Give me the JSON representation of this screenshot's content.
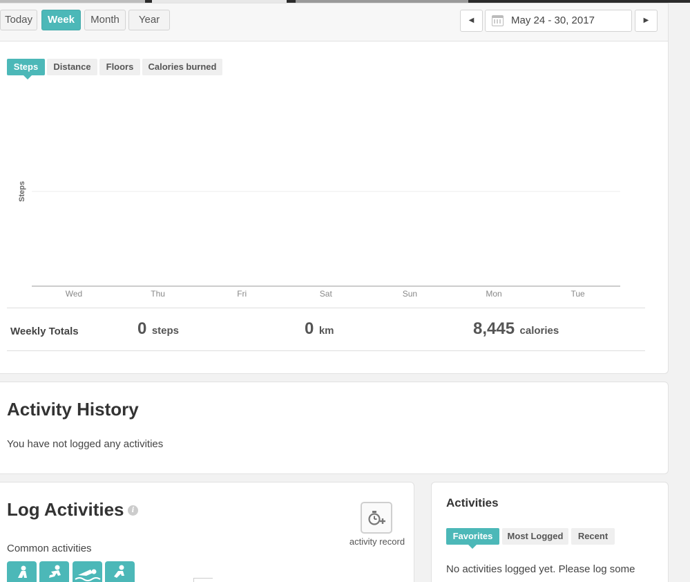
{
  "toolbar": {
    "range_buttons": [
      "Today",
      "Week",
      "Month",
      "Year"
    ],
    "active_range": "Week",
    "date_range": "May 24 - 30, 2017"
  },
  "metric_tabs": [
    "Steps",
    "Distance",
    "Floors",
    "Calories burned"
  ],
  "active_metric": "Steps",
  "chart_data": {
    "type": "bar",
    "categories": [
      "Wed",
      "Thu",
      "Fri",
      "Sat",
      "Sun",
      "Mon",
      "Tue"
    ],
    "values": [
      0,
      0,
      0,
      0,
      0,
      0,
      0
    ],
    "title": "",
    "xlabel": "",
    "ylabel": "Steps",
    "grid": true
  },
  "weekly_totals": {
    "label": "Weekly Totals",
    "steps_value": "0",
    "steps_unit": "steps",
    "distance_value": "0",
    "distance_unit": "km",
    "calories_value": "8,445",
    "calories_unit": "calories"
  },
  "activity_history": {
    "title": "Activity History",
    "message": "You have not logged any activities"
  },
  "log_activities": {
    "title": "Log Activities",
    "info_icon": "info-icon",
    "record_icon": "stopwatch-plus-icon",
    "record_label": "activity record",
    "common_label": "Common activities",
    "common_icons": [
      "walking-icon",
      "running-icon",
      "swimming-icon",
      "cycling-icon"
    ]
  },
  "activities_panel": {
    "title": "Activities",
    "tabs": [
      "Favorites",
      "Most Logged",
      "Recent"
    ],
    "active_tab": "Favorites",
    "message": "No activities logged yet. Please log some"
  },
  "colors": {
    "accent": "#4cb8b8",
    "background": "#f2f2f2",
    "panel": "#ffffff"
  }
}
